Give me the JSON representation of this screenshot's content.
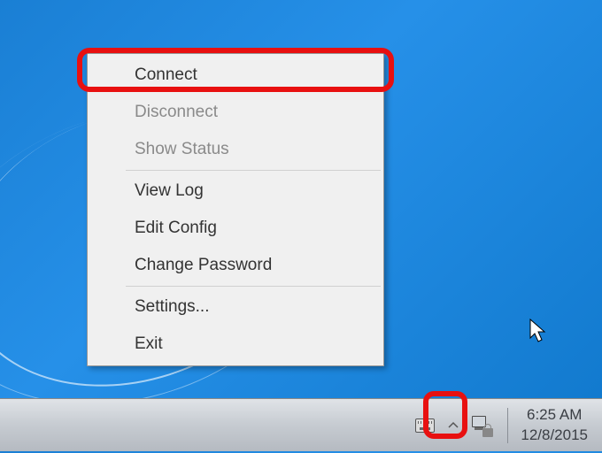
{
  "context_menu": {
    "items": [
      {
        "label": "Connect",
        "enabled": true
      },
      {
        "label": "Disconnect",
        "enabled": false
      },
      {
        "label": "Show Status",
        "enabled": false
      },
      {
        "label": "View Log",
        "enabled": true
      },
      {
        "label": "Edit Config",
        "enabled": true
      },
      {
        "label": "Change Password",
        "enabled": true
      },
      {
        "label": "Settings...",
        "enabled": true
      },
      {
        "label": "Exit",
        "enabled": true
      }
    ]
  },
  "taskbar": {
    "time": "6:25 AM",
    "date": "12/8/2015"
  },
  "highlights": {
    "connect_border_color": "#e81010",
    "tray_border_color": "#e81010"
  }
}
